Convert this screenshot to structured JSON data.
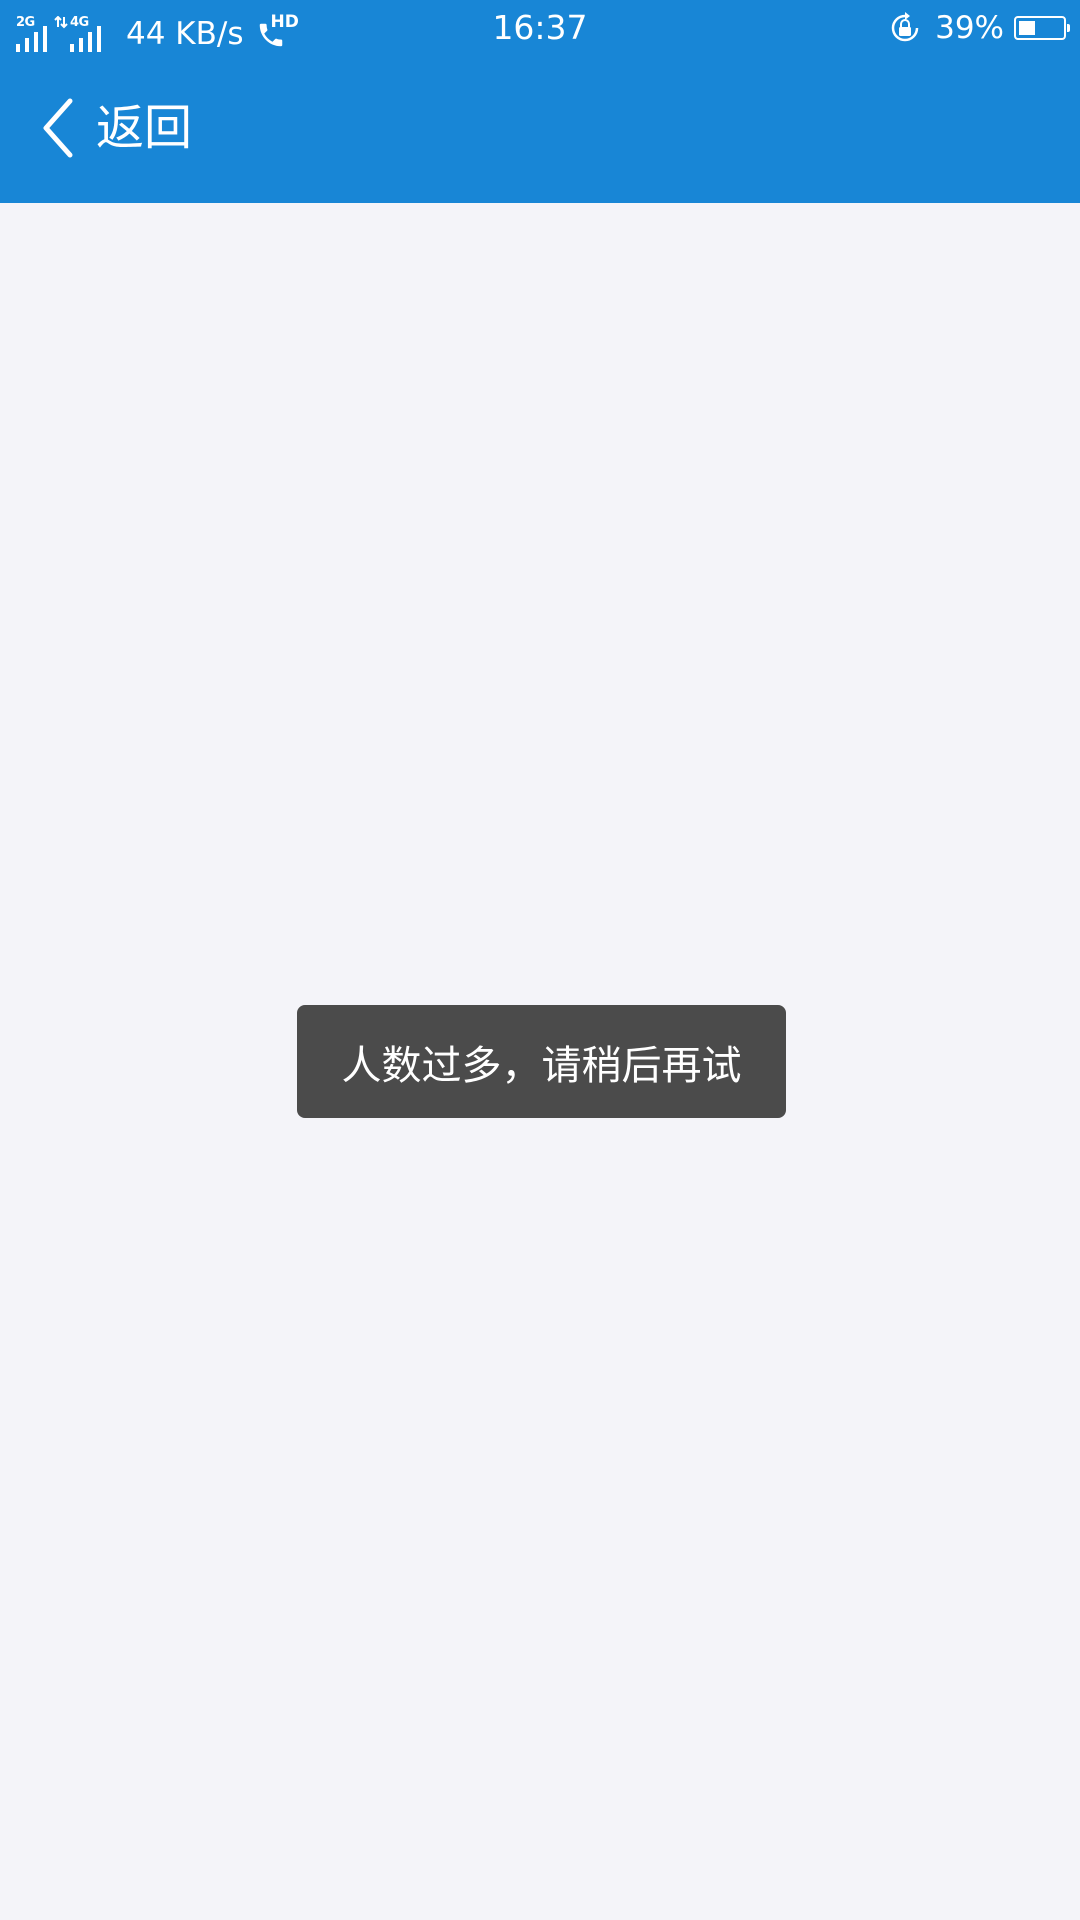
{
  "status_bar": {
    "sim1_network": "2G",
    "sim2_network": "4G",
    "net_speed": "44 KB/s",
    "volte_label": "HD",
    "time": "16:37",
    "battery_percent": "39%",
    "battery_level": 0.39,
    "icons": [
      "signal-icon",
      "data-arrows-icon",
      "signal-icon",
      "phone-hd-icon",
      "rotation-lock-icon",
      "battery-icon"
    ]
  },
  "header": {
    "back_label": "返回",
    "background_color": "#1886d6",
    "icon": "chevron-left-icon"
  },
  "toast": {
    "message": "人数过多，请稍后再试",
    "background_color": "#4b4b4b"
  },
  "page": {
    "background_color": "#f4f4f9"
  }
}
